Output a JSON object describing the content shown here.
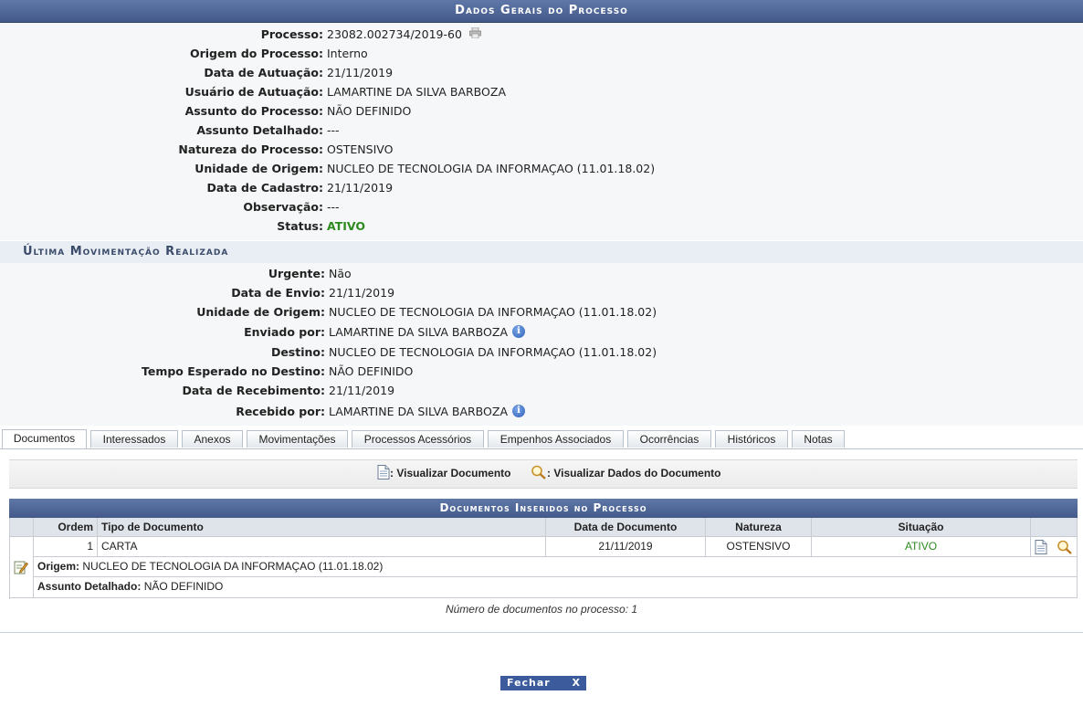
{
  "header": {
    "title": "Dados Gerais do Processo"
  },
  "general": [
    {
      "label": "Processo:",
      "value": "23082.002734/2019-60"
    },
    {
      "label": "Origem do Processo:",
      "value": "Interno"
    },
    {
      "label": "Data de Autuação:",
      "value": "21/11/2019"
    },
    {
      "label": "Usuário de Autuação:",
      "value": "LAMARTINE DA SILVA BARBOZA"
    },
    {
      "label": "Assunto do Processo:",
      "value": "NÃO DEFINIDO"
    },
    {
      "label": "Assunto Detalhado:",
      "value": "---"
    },
    {
      "label": "Natureza do Processo:",
      "value": "OSTENSIVO"
    },
    {
      "label": "Unidade de Origem:",
      "value": "NUCLEO DE TECNOLOGIA DA INFORMAÇAO (11.01.18.02)"
    },
    {
      "label": "Data de Cadastro:",
      "value": "21/11/2019"
    },
    {
      "label": "Observação:",
      "value": "---"
    },
    {
      "label": "Status:",
      "value": "ATIVO"
    }
  ],
  "movement": {
    "title": "Última Movimentação Realizada",
    "rows": [
      {
        "label": "Urgente:",
        "value": "Não"
      },
      {
        "label": "Data de Envio:",
        "value": "21/11/2019"
      },
      {
        "label": "Unidade de Origem:",
        "value": "NUCLEO DE TECNOLOGIA DA INFORMAÇAO (11.01.18.02)"
      },
      {
        "label": "Enviado por:",
        "value": "LAMARTINE DA SILVA BARBOZA"
      },
      {
        "label": "Destino:",
        "value": "NUCLEO DE TECNOLOGIA DA INFORMAÇAO (11.01.18.02)"
      },
      {
        "label": "Tempo Esperado no Destino:",
        "value": "NÃO DEFINIDO"
      },
      {
        "label": "Data de Recebimento:",
        "value": "21/11/2019"
      },
      {
        "label": "Recebido por:",
        "value": "LAMARTINE DA SILVA BARBOZA"
      }
    ]
  },
  "tabs": [
    "Documentos",
    "Interessados",
    "Anexos",
    "Movimentações",
    "Processos Acessórios",
    "Empenhos Associados",
    "Ocorrências",
    "Históricos",
    "Notas"
  ],
  "legend": {
    "view_doc": ": Visualizar Documento",
    "view_data": ": Visualizar Dados do Documento"
  },
  "documents": {
    "title": "Documentos Inseridos no Processo",
    "columns": [
      "Ordem",
      "Tipo de Documento",
      "Data de Documento",
      "Natureza",
      "Situação"
    ],
    "rows": [
      {
        "ordem": "1",
        "tipo": "CARTA",
        "data": "21/11/2019",
        "natureza": "OSTENSIVO",
        "situacao": "ATIVO",
        "origem_label": "Origem:",
        "origem_value": "NUCLEO DE TECNOLOGIA DA INFORMAÇAO (11.01.18.02)",
        "assunto_label": "Assunto Detalhado:",
        "assunto_value": "NÃO DEFINIDO"
      }
    ],
    "count_text": "Número de documentos no processo: 1"
  },
  "close_button": {
    "label": "Fechar",
    "x": "X"
  },
  "colors": {
    "header": "#4a6194",
    "status_active": "#2c8a1e",
    "button": "#3b5b9c"
  }
}
